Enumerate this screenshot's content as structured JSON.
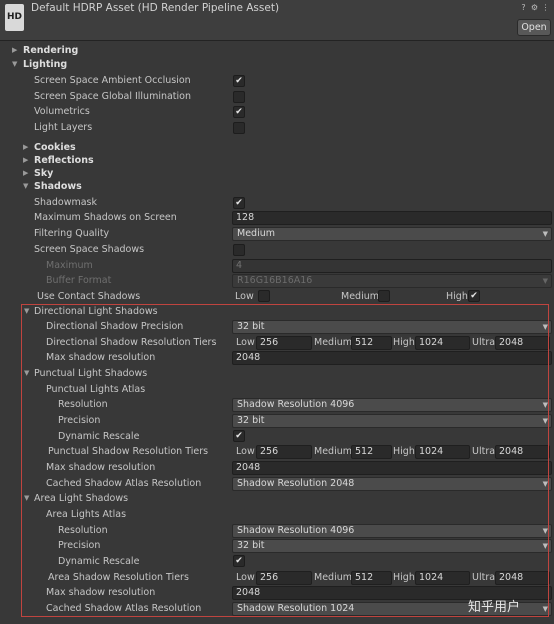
{
  "header": {
    "logo_text": "HD",
    "title": "Default HDRP Asset (HD Render Pipeline Asset)",
    "help_icon": "?",
    "settings_icon": "⚙",
    "more_icon": "⋮",
    "open_label": "Open"
  },
  "sections": {
    "rendering": "Rendering",
    "lighting": "Lighting",
    "cookies": "Cookies",
    "reflections": "Reflections",
    "sky": "Sky",
    "shadows": "Shadows"
  },
  "lighting": {
    "ssao": {
      "label": "Screen Space Ambient Occlusion",
      "checked": true
    },
    "ssgi": {
      "label": "Screen Space Global Illumination",
      "checked": false
    },
    "volumetrics": {
      "label": "Volumetrics",
      "checked": true
    },
    "light_layers": {
      "label": "Light Layers",
      "checked": false
    }
  },
  "shadows": {
    "shadowmask": {
      "label": "Shadowmask",
      "checked": true
    },
    "max_shadows": {
      "label": "Maximum Shadows on Screen",
      "value": "128"
    },
    "filtering_quality": {
      "label": "Filtering Quality",
      "value": "Medium"
    },
    "ss_shadows": {
      "label": "Screen Space Shadows",
      "checked": false
    },
    "maximum": {
      "label": "Maximum",
      "value": "4"
    },
    "buffer_format": {
      "label": "Buffer Format",
      "value": "R16G16B16A16"
    },
    "contact_shadows": {
      "label": "Use Contact Shadows",
      "low": "Low",
      "medium": "Medium",
      "high": "High",
      "low_checked": false,
      "medium_checked": false,
      "high_checked": true
    }
  },
  "directional": {
    "header": "Directional Light Shadows",
    "precision": {
      "label": "Directional Shadow Precision",
      "value": "32 bit"
    },
    "tiers": {
      "label": "Directional Shadow Resolution Tiers",
      "low_label": "Low",
      "low": "256",
      "medium_label": "Medium",
      "medium": "512",
      "high_label": "High",
      "high": "1024",
      "ultra_label": "Ultra",
      "ultra": "2048"
    },
    "max_res": {
      "label": "Max shadow resolution",
      "value": "2048"
    }
  },
  "punctual": {
    "header": "Punctual Light Shadows",
    "atlas": "Punctual Lights Atlas",
    "resolution": {
      "label": "Resolution",
      "value": "Shadow Resolution 4096"
    },
    "precision": {
      "label": "Precision",
      "value": "32 bit"
    },
    "dynamic_rescale": {
      "label": "Dynamic Rescale",
      "checked": true
    },
    "tiers": {
      "label": "Punctual Shadow Resolution Tiers",
      "low_label": "Low",
      "low": "256",
      "medium_label": "Medium",
      "medium": "512",
      "high_label": "High",
      "high": "1024",
      "ultra_label": "Ultra",
      "ultra": "2048"
    },
    "max_res": {
      "label": "Max shadow resolution",
      "value": "2048"
    },
    "cached": {
      "label": "Cached Shadow Atlas Resolution",
      "value": "Shadow Resolution 2048"
    }
  },
  "area": {
    "header": "Area Light Shadows",
    "atlas": "Area Lights Atlas",
    "resolution": {
      "label": "Resolution",
      "value": "Shadow Resolution 4096"
    },
    "precision": {
      "label": "Precision",
      "value": "32 bit"
    },
    "dynamic_rescale": {
      "label": "Dynamic Rescale",
      "checked": true
    },
    "tiers": {
      "label": "Area Shadow Resolution Tiers",
      "low_label": "Low",
      "low": "256",
      "medium_label": "Medium",
      "medium": "512",
      "high_label": "High",
      "high": "1024",
      "ultra_label": "Ultra",
      "ultra": "2048"
    },
    "max_res": {
      "label": "Max shadow resolution",
      "value": "2048"
    },
    "cached": {
      "label": "Cached Shadow Atlas Resolution",
      "value": "Shadow Resolution 1024"
    }
  },
  "glyphs": {
    "check": "✔",
    "fold_open": "▼",
    "fold_closed": "▶",
    "dropdown_arrow": "▼"
  },
  "watermark": "知乎用户",
  "colors": {
    "highlight_border": "#c0443f",
    "background": "#383838"
  }
}
